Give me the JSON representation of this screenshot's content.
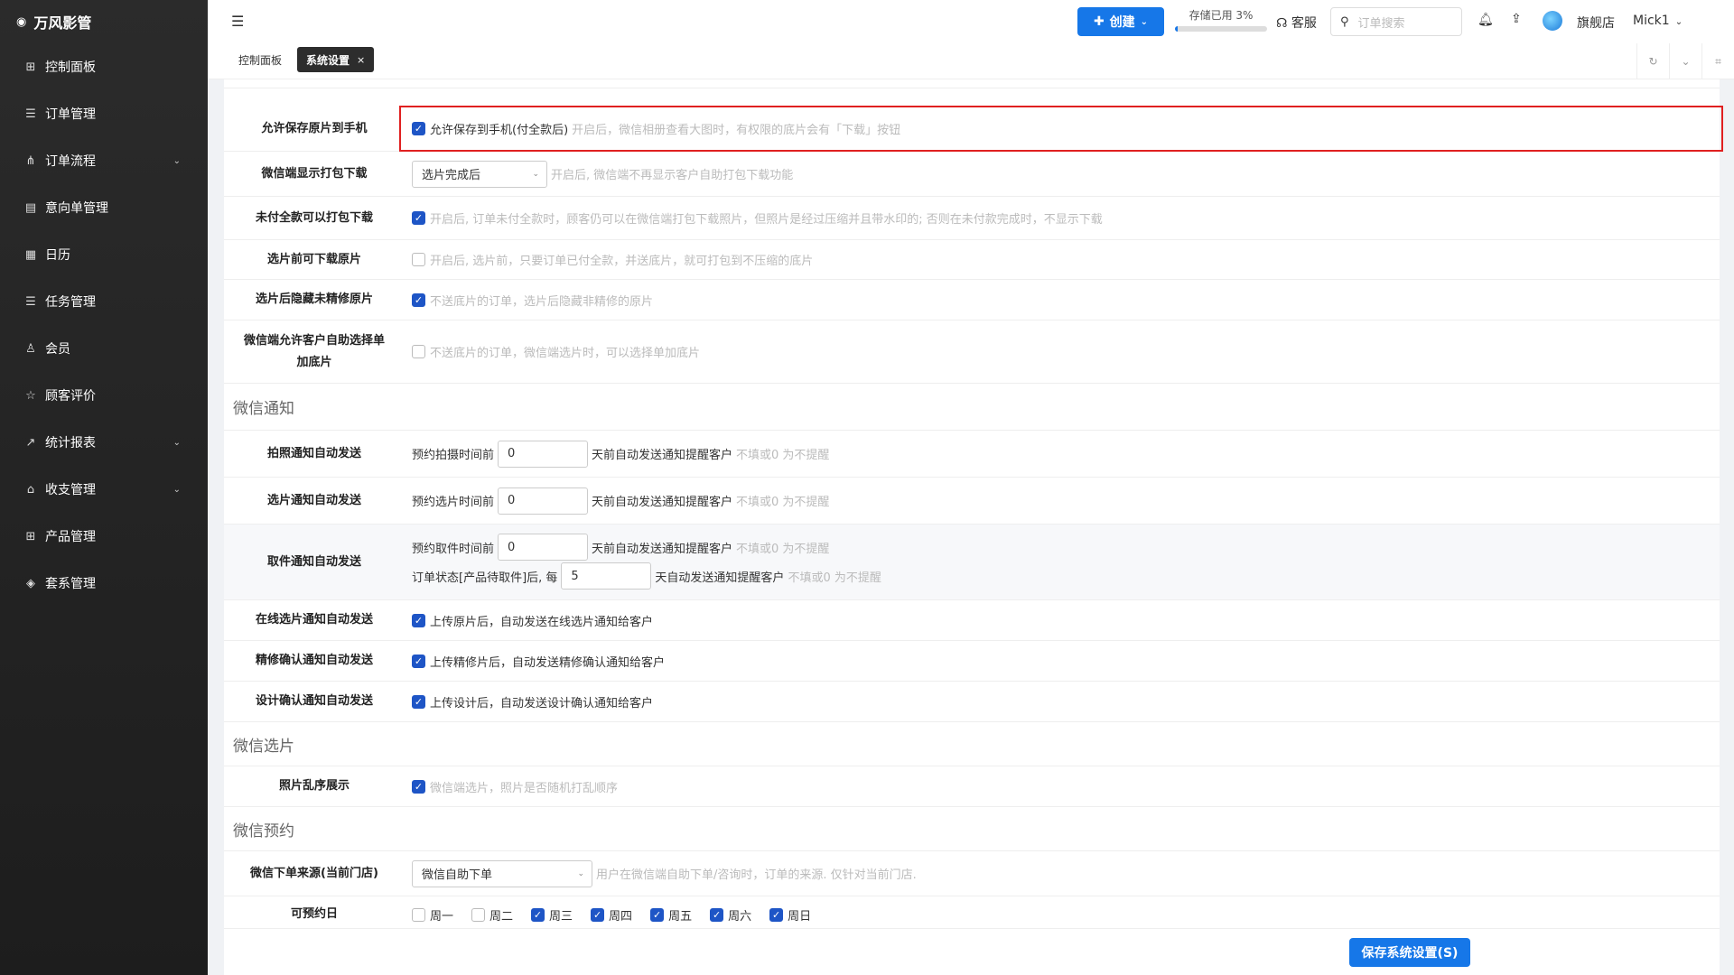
{
  "app": {
    "title": "万风影管",
    "brand_icon": "camera-icon"
  },
  "sidebar": {
    "items": [
      {
        "label": "控制面板",
        "icon": "grid-icon",
        "expandable": false
      },
      {
        "label": "订单管理",
        "icon": "list-icon",
        "expandable": false
      },
      {
        "label": "订单流程",
        "icon": "flow-icon",
        "expandable": true
      },
      {
        "label": "意向单管理",
        "icon": "clipboard-icon",
        "expandable": false
      },
      {
        "label": "日历",
        "icon": "calendar-icon",
        "expandable": false
      },
      {
        "label": "任务管理",
        "icon": "tasks-icon",
        "expandable": false
      },
      {
        "label": "会员",
        "icon": "user-icon",
        "expandable": false
      },
      {
        "label": "顾客评价",
        "icon": "star-icon",
        "expandable": false
      },
      {
        "label": "统计报表",
        "icon": "chart-icon",
        "expandable": true
      },
      {
        "label": "收支管理",
        "icon": "bank-icon",
        "expandable": true
      },
      {
        "label": "产品管理",
        "icon": "product-icon",
        "expandable": false
      },
      {
        "label": "套系管理",
        "icon": "package-icon",
        "expandable": false
      }
    ]
  },
  "topbar": {
    "create_label": "创建",
    "storage_label": "存储已用 3%",
    "storage_percent": 3,
    "service_label": "客服",
    "search_placeholder": "订单搜索",
    "store_label": "旗舰店",
    "user_label": "Mick1"
  },
  "tabs": [
    {
      "label": "控制面板",
      "active": false
    },
    {
      "label": "系统设置",
      "active": true
    }
  ],
  "rows": {
    "save_original": {
      "label": "允许保存原片到手机",
      "option": "允许保存到手机(付全款后)",
      "checked": true,
      "hint": "开启后，微信相册查看大图时，有权限的底片会有「下载」按钮"
    },
    "pack_download": {
      "label": "微信端显示打包下载",
      "select": "选片完成后",
      "hint": "开启后, 微信端不再显示客户自助打包下载功能"
    },
    "unpaid_pack": {
      "label": "未付全款可以打包下载",
      "checked": true,
      "hint": "开启后, 订单未付全款时，顾客仍可以在微信端打包下载照片，但照片是经过压缩并且带水印的; 否则在未付款完成时，不显示下载"
    },
    "pre_select_download": {
      "label": "选片前可下载原片",
      "checked": false,
      "hint": "开启后, 选片前，只要订单已付全款，并送底片，就可打包到不压缩的底片"
    },
    "hide_unretouched": {
      "label": "选片后隐藏未精修原片",
      "checked": true,
      "hint": "不送底片的订单，选片后隐藏非精修的原片"
    },
    "self_select": {
      "label": "微信端允许客户自助选择单加底片",
      "checked": false,
      "hint": "不送底片的订单，微信端选片时，可以选择单加底片"
    }
  },
  "sections": {
    "wechat_notify": "微信通知",
    "wechat_select": "微信选片",
    "wechat_booking": "微信预约"
  },
  "notify": {
    "shoot": {
      "label": "拍照通知自动发送",
      "prefix": "预约拍摄时间前",
      "value": "0",
      "suffix": "天前自动发送通知提醒客户",
      "hint": "不填或0 为不提醒"
    },
    "select": {
      "label": "选片通知自动发送",
      "prefix": "预约选片时间前",
      "value": "0",
      "suffix": "天前自动发送通知提醒客户",
      "hint": "不填或0 为不提醒"
    },
    "pickup": {
      "label": "取件通知自动发送",
      "prefix": "预约取件时间前",
      "value": "0",
      "suffix": "天前自动发送通知提醒客户",
      "hint": "不填或0 为不提醒",
      "prefix2": "订单状态[产品待取件]后, 每",
      "value2": "5",
      "suffix2": "天自动发送通知提醒客户",
      "hint2": "不填或0 为不提醒"
    },
    "online": {
      "label": "在线选片通知自动发送",
      "checked": true,
      "text": "上传原片后，自动发送在线选片通知给客户"
    },
    "retouch": {
      "label": "精修确认通知自动发送",
      "checked": true,
      "text": "上传精修片后，自动发送精修确认通知给客户"
    },
    "design": {
      "label": "设计确认通知自动发送",
      "checked": true,
      "text": "上传设计后，自动发送设计确认通知给客户"
    }
  },
  "select_settings": {
    "shuffle": {
      "label": "照片乱序展示",
      "checked": true,
      "hint": "微信端选片，照片是否随机打乱顺序"
    }
  },
  "booking": {
    "source": {
      "label": "微信下单来源(当前门店)",
      "select": "微信自助下单",
      "hint": "用户在微信端自助下单/咨询时，订单的来源. 仅针对当前门店."
    },
    "days": {
      "label": "可预约日",
      "items": [
        {
          "label": "周一",
          "checked": false
        },
        {
          "label": "周二",
          "checked": false
        },
        {
          "label": "周三",
          "checked": true
        },
        {
          "label": "周四",
          "checked": true
        },
        {
          "label": "周五",
          "checked": true
        },
        {
          "label": "周六",
          "checked": true
        },
        {
          "label": "周日",
          "checked": true
        }
      ]
    }
  },
  "footer": {
    "save_label": "保存系统设置(S)"
  },
  "colors": {
    "accent": "#1677e8",
    "checkbox": "#1e55c6",
    "highlight": "#e02020",
    "sidebar": "#222222"
  }
}
